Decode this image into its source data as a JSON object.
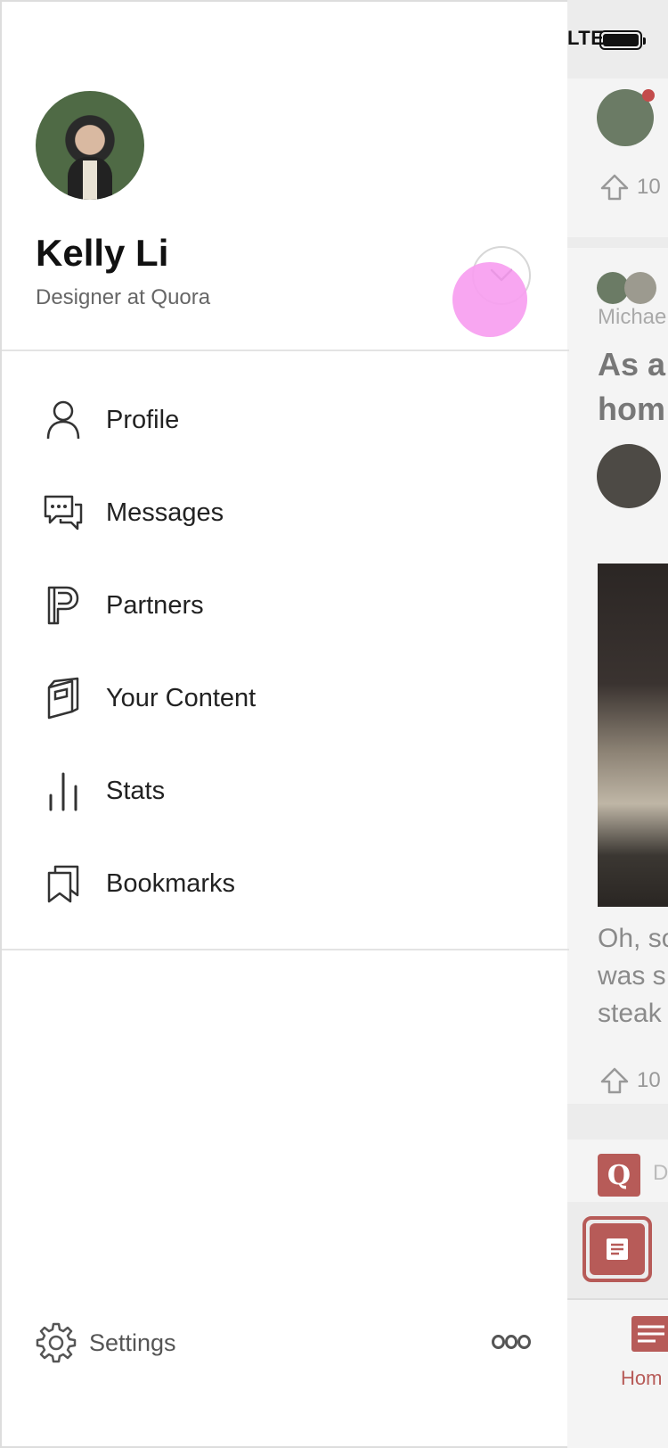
{
  "status_bar": {
    "network": "LTE"
  },
  "profile": {
    "name": "Kelly Li",
    "title": "Designer at Quora"
  },
  "menu": [
    {
      "label": "Profile",
      "icon": "person-icon"
    },
    {
      "label": "Messages",
      "icon": "messages-icon"
    },
    {
      "label": "Partners",
      "icon": "partners-icon"
    },
    {
      "label": "Your Content",
      "icon": "content-icon"
    },
    {
      "label": "Stats",
      "icon": "stats-icon"
    },
    {
      "label": "Bookmarks",
      "icon": "bookmarks-icon"
    }
  ],
  "footer": {
    "settings_label": "Settings"
  },
  "feed": {
    "upvote_count": "10",
    "author": "Michae",
    "question_line1": "As a",
    "question_line2": "hom",
    "snippet_line1": "Oh, so",
    "snippet_line2": "was s",
    "snippet_line3": "steak",
    "upvote_count_2": "10",
    "ask_prefix": "D",
    "badge": "Q",
    "tab_home": "Hom"
  },
  "colors": {
    "brand": "#b75b58",
    "touch_indicator": "#f79ef0",
    "text_primary": "#111111",
    "text_secondary": "#666666"
  }
}
